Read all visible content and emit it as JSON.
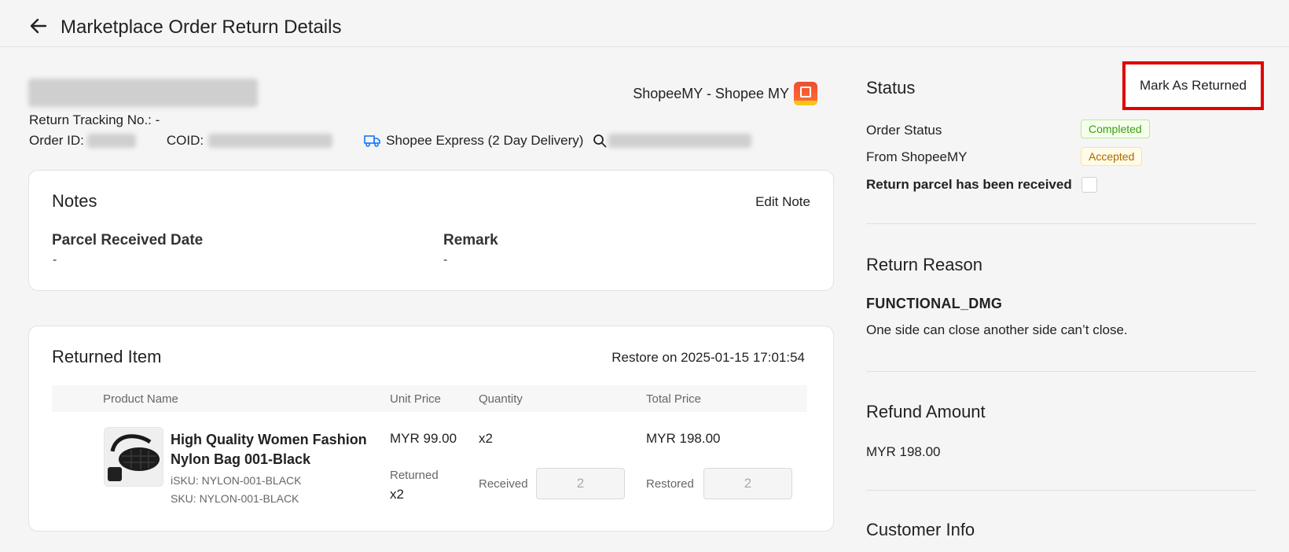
{
  "header": {
    "title": "Marketplace Order Return Details",
    "back_icon": "arrow-left-icon"
  },
  "order": {
    "platform": "ShopeeMY - Shopee MY",
    "platform_logo": "shopee-logo",
    "return_tracking_label": "Return Tracking No.: -",
    "order_id_label": "Order ID:",
    "coid_label": "COID:",
    "courier": "Shopee Express (2 Day Delivery)",
    "courier_icon": "truck-icon",
    "search_icon": "search-icon"
  },
  "notes": {
    "title": "Notes",
    "edit_label": "Edit Note",
    "parcel_received_label": "Parcel Received Date",
    "parcel_received_value": "-",
    "remark_label": "Remark",
    "remark_value": "-"
  },
  "returned_item": {
    "title": "Returned Item",
    "restore_on": "Restore on 2025-01-15 17:01:54",
    "columns": [
      "Product Name",
      "Unit Price",
      "Quantity",
      "Total Price"
    ],
    "product": {
      "name": "High Quality Women Fashion Nylon Bag 001-Black",
      "isku": "iSKU: NYLON-001-BLACK",
      "sku": "SKU: NYLON-001-BLACK",
      "unit_price": "MYR 99.00",
      "quantity": "x2",
      "total_price": "MYR 198.00",
      "returned_label": "Returned",
      "returned_value": "x2",
      "received_label": "Received",
      "received_value": "2",
      "restored_label": "Restored",
      "restored_value": "2"
    }
  },
  "status_panel": {
    "title": "Status",
    "mark_button": "Mark As Returned",
    "order_status_label": "Order Status",
    "order_status_value": "Completed",
    "from_label": "From ShopeeMY",
    "from_value": "Accepted",
    "received_label": "Return parcel has been received",
    "received_checked": false,
    "colors": {
      "completed": "#389e0d",
      "accepted": "#ad6800",
      "highlight": "#e00000"
    }
  },
  "return_reason": {
    "title": "Return Reason",
    "code": "FUNCTIONAL_DMG",
    "text": "One side can close another side can’t close."
  },
  "refund": {
    "title": "Refund Amount",
    "amount": "MYR 198.00"
  },
  "customer": {
    "title": "Customer Info"
  }
}
